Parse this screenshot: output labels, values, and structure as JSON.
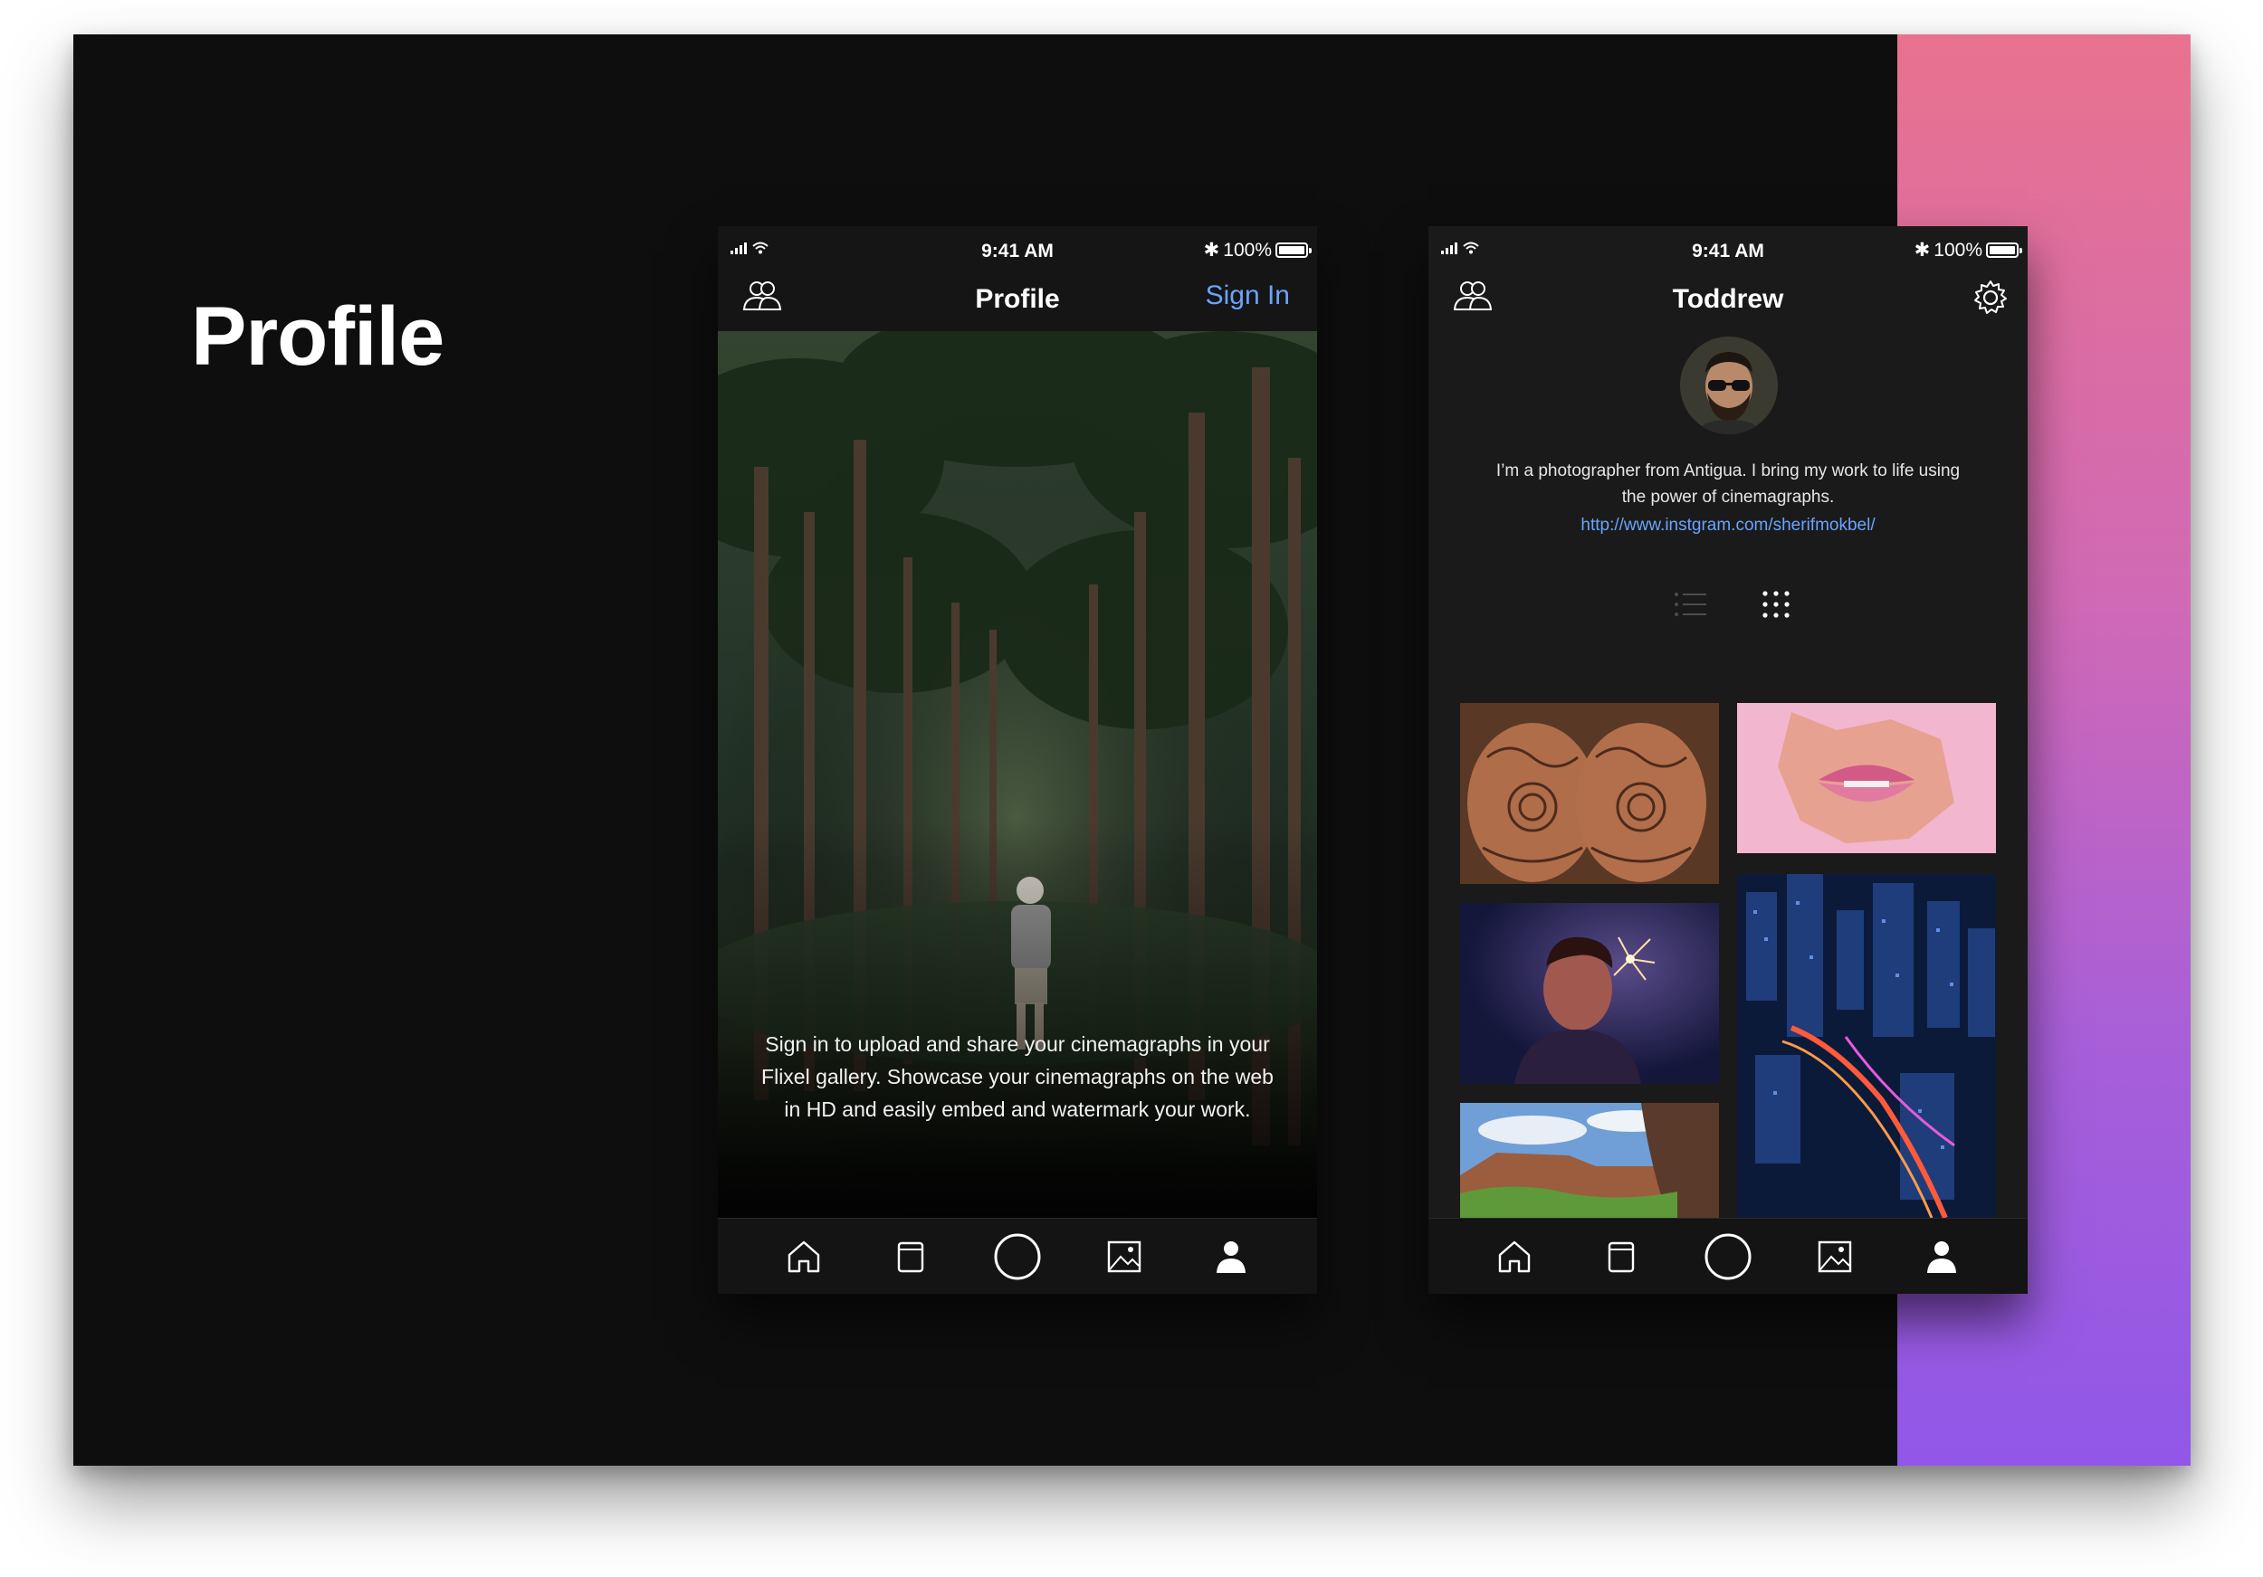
{
  "slide": {
    "title": "Profile"
  },
  "colors": {
    "accent_top": "#e8728e",
    "accent_bottom": "#9157e8",
    "link": "#6aa3ff",
    "background": "#0e0e0e"
  },
  "status_bar": {
    "time": "9:41 AM",
    "battery": "100%"
  },
  "screen_signed_out": {
    "title": "Profile",
    "left_icon": "people-icon",
    "sign_in_label": "Sign In",
    "message": "Sign in to upload and share your cinemagraphs in your Flixel gallery. Showcase your cinemagraphs on the web in HD and easily embed and watermark your work."
  },
  "screen_profile": {
    "username": "Toddrew",
    "left_icon": "people-icon",
    "right_icon": "gear-icon",
    "bio": "I’m a photographer from Antigua. I bring my work to life using the power of cinemagraphs.",
    "link": "http://www.instgram.com/sherifmokbel/",
    "view_modes": [
      "list-view-icon",
      "grid-view-icon"
    ],
    "selected_view": "grid-view-icon",
    "gallery": [
      "henna-hands-photo",
      "pink-lips-photo",
      "sparkler-portrait-photo",
      "city-night-aerial-photo",
      "canyon-landscape-photo"
    ]
  },
  "tab_bar": {
    "items": [
      "home-icon",
      "book-icon",
      "capture-circle-icon",
      "gallery-icon",
      "profile-icon"
    ]
  }
}
